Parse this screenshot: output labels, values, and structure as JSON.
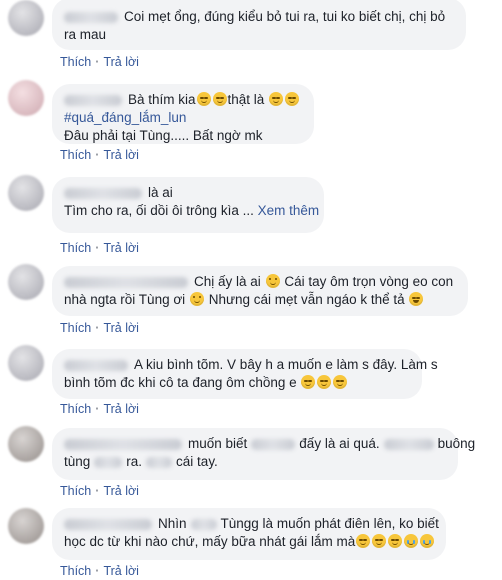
{
  "actions": {
    "like": "Thích",
    "reply": "Trả lời",
    "separator": "·"
  },
  "comments": [
    {
      "lines": [
        "Coi mẹt ổng, đúng kiểu bỏ tui ra, tui ko biết chị, chị bỏ",
        "ra mau"
      ]
    },
    {
      "lines": [
        "Bà thím kia",
        "thật là",
        "#quá_đáng_lắm_lun",
        "Đâu phải tại Tùng..... Bất ngờ mk"
      ]
    },
    {
      "lines": [
        "là ai",
        "Tìm cho ra, ối dồi ôi trông kìa ...",
        "Xem thêm"
      ]
    },
    {
      "lines": [
        "Chị ấy là ai",
        "Cái tay ôm trọn vòng eo con",
        "nhà ngta rồi Tùng ơi",
        "Nhưng cái mẹt vẫn ngáo k thể tả"
      ]
    },
    {
      "lines": [
        "A kiu bình tõm. V bây h a muốn e làm s đây. Làm s",
        "bình tõm đc khi cô ta đang ôm chồng e"
      ]
    },
    {
      "lines": [
        "muốn biết",
        "đấy là ai quá.",
        "buông",
        "tùng",
        "ra.",
        "cái tay."
      ]
    },
    {
      "lines": [
        "Nhìn",
        "Tùngg là muốn phát điên lên, ko biết",
        "học dc từ khi nào chứ, mấy bữa nhát gái lắm mà"
      ]
    }
  ],
  "emoji_icons": [
    "relieved-emoji-icon",
    "smile-emoji-icon",
    "laugh-emoji-icon",
    "cry-emoji-icon"
  ]
}
